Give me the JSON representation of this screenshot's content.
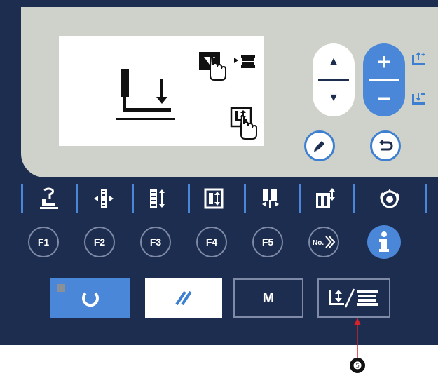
{
  "function_keys": {
    "f1": "F1",
    "f2": "F2",
    "f3": "F3",
    "f4": "F4",
    "f5": "F5"
  },
  "bottom_keys": {
    "m_label": "M"
  },
  "callout": {
    "number": "❺"
  },
  "colors": {
    "panel": "#1d2d4f",
    "accent_blue": "#4a87d8",
    "bezel_gray": "#cfd1cb",
    "callout_red": "#d8222a"
  },
  "icons": {
    "lcd_icons": [
      "presser-foot-down-icon",
      "hand-press-icon",
      "bobbin-winder-icon",
      "hand-press-icon"
    ],
    "header_icons": [
      "up-arrow-icon",
      "down-arrow-icon",
      "plus-icon",
      "minus-icon",
      "edit-pencil-icon",
      "return-icon"
    ],
    "row_icons": [
      "presser-foot-icon",
      "needle-position-icon",
      "stitch-density-icon",
      "pattern-length-icon",
      "stitch-width-icon",
      "pattern-change-icon",
      "thread-tension-icon"
    ]
  }
}
